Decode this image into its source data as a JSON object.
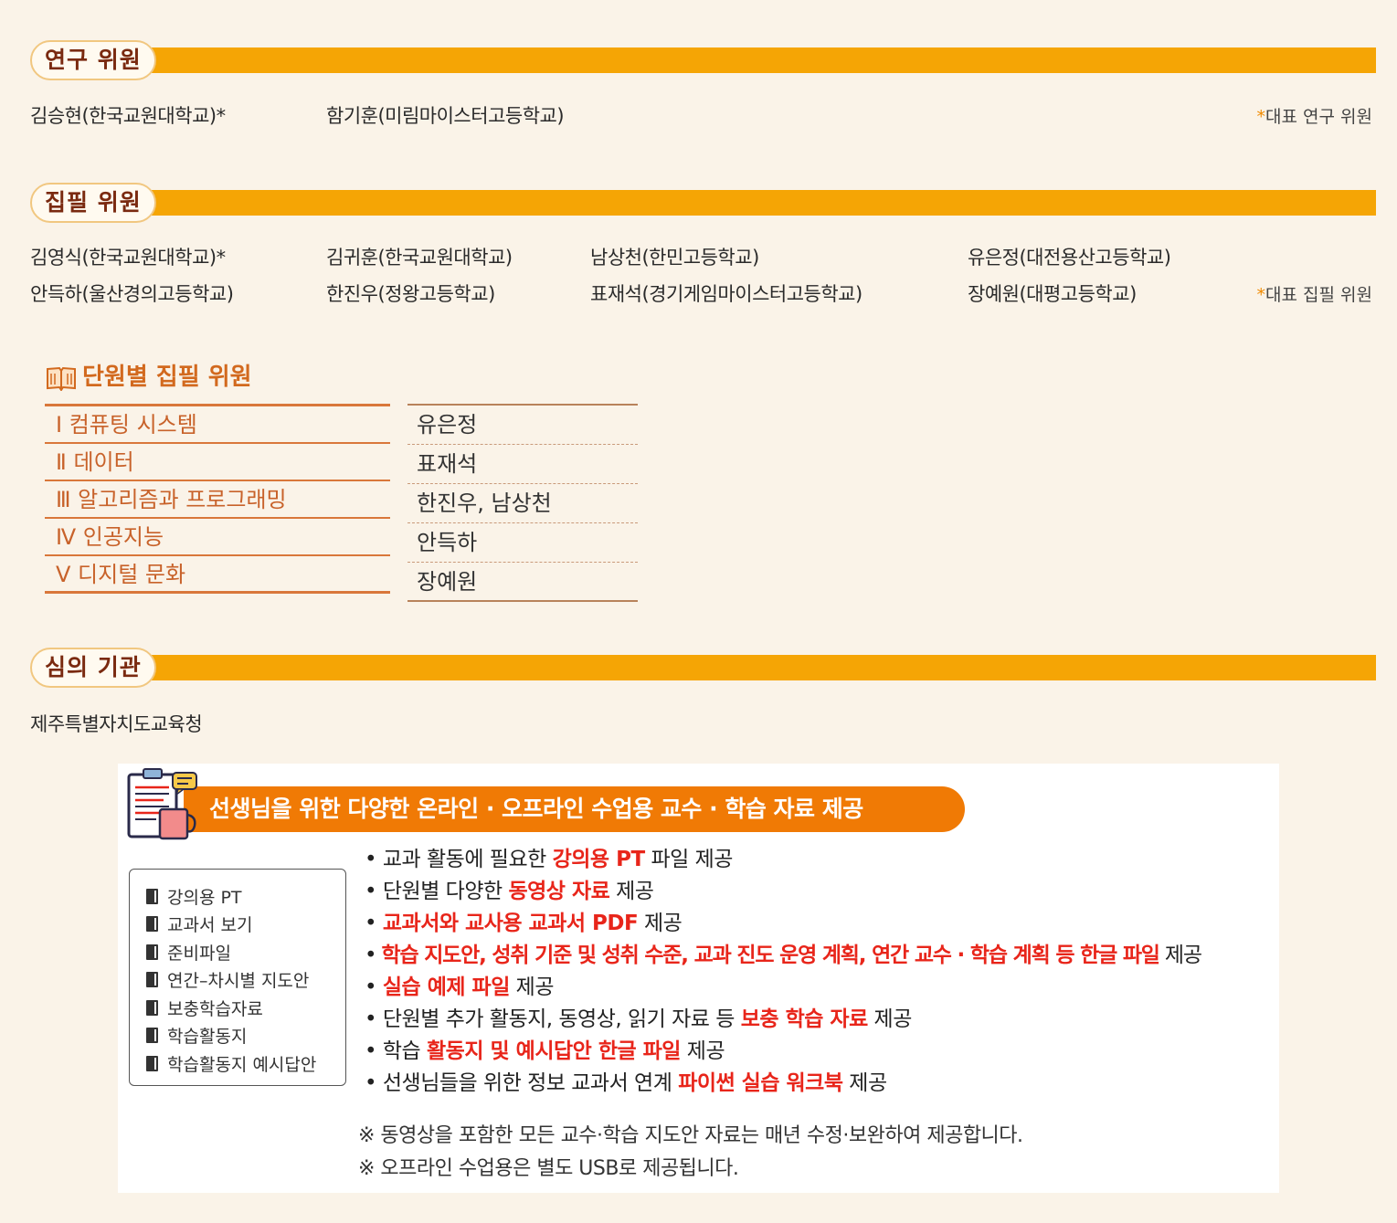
{
  "research": {
    "title": "연구 위원",
    "members": [
      "김승현(한국교원대학교)*",
      "함기훈(미림마이스터고등학교)"
    ],
    "note_star": "*",
    "note_text": "대표 연구 위원"
  },
  "writing": {
    "title": "집필 위원",
    "row1": [
      "김영식(한국교원대학교)*",
      "김귀훈(한국교원대학교)",
      "남상천(한민고등학교)",
      "유은정(대전용산고등학교)"
    ],
    "row2": [
      "안득하(울산경의고등학교)",
      "한진우(정왕고등학교)",
      "표재석(경기게임마이스터고등학교)",
      "장예원(대평고등학교)"
    ],
    "note_star": "*",
    "note_text": "대표 집필 위원"
  },
  "units": {
    "title": "단원별 집필 위원",
    "rows": [
      {
        "unit": "Ⅰ 컴퓨팅 시스템",
        "authors": "유은정"
      },
      {
        "unit": "Ⅱ 데이터",
        "authors": "표재석"
      },
      {
        "unit": "Ⅲ 알고리즘과 프로그래밍",
        "authors": "한진우, 남상천"
      },
      {
        "unit": "Ⅳ 인공지능",
        "authors": "안득하"
      },
      {
        "unit": "Ⅴ 디지털 문화",
        "authors": "장예원"
      }
    ]
  },
  "review": {
    "title": "심의 기관",
    "org": "제주특별자치도교육청"
  },
  "promo": {
    "banner": "선생님을 위한 다양한 온라인 · 오프라인 수업용 교수 · 학습 자료 제공",
    "menu": [
      "강의용 PT",
      "교과서 보기",
      "준비파일",
      "연간–차시별 지도안",
      "보충학습자료",
      "학습활동지",
      "학습활동지 예시답안"
    ],
    "bullets": [
      {
        "pre": "• 교과 활동에 필요한 ",
        "hl": "강의용 PT",
        "post": " 파일 제공"
      },
      {
        "pre": "• 단원별 다양한 ",
        "hl": "동영상 자료",
        "post": " 제공"
      },
      {
        "pre": "• ",
        "hl": "교과서와 교사용 교과서 PDF",
        "post": " 제공"
      },
      {
        "pre": "• ",
        "hl": "학습 지도안, 성취 기준 및 성취 수준, 교과 진도 운영 계획, 연간 교수 · 학습 계획 등 한글 파일",
        "post": " 제공"
      },
      {
        "pre": "• ",
        "hl": "실습 예제 파일",
        "post": " 제공"
      },
      {
        "pre": "• 단원별 추가 활동지, 동영상, 읽기 자료 등 ",
        "hl": "보충 학습 자료",
        "post": " 제공"
      },
      {
        "pre": "• 학습 ",
        "hl": "활동지 및 예시답안 한글 파일",
        "post": " 제공"
      },
      {
        "pre": "• 선생님들을 위한 정보 교과서 연계 ",
        "hl": "파이썬 실습 워크북",
        "post": " 제공"
      }
    ],
    "footnotes": [
      "※ 동영상을 포함한 모든 교수·학습 지도안 자료는 매년 수정·보완하여 제공합니다.",
      "※ 오프라인 수업용은 별도 USB로 제공됩니다."
    ]
  }
}
